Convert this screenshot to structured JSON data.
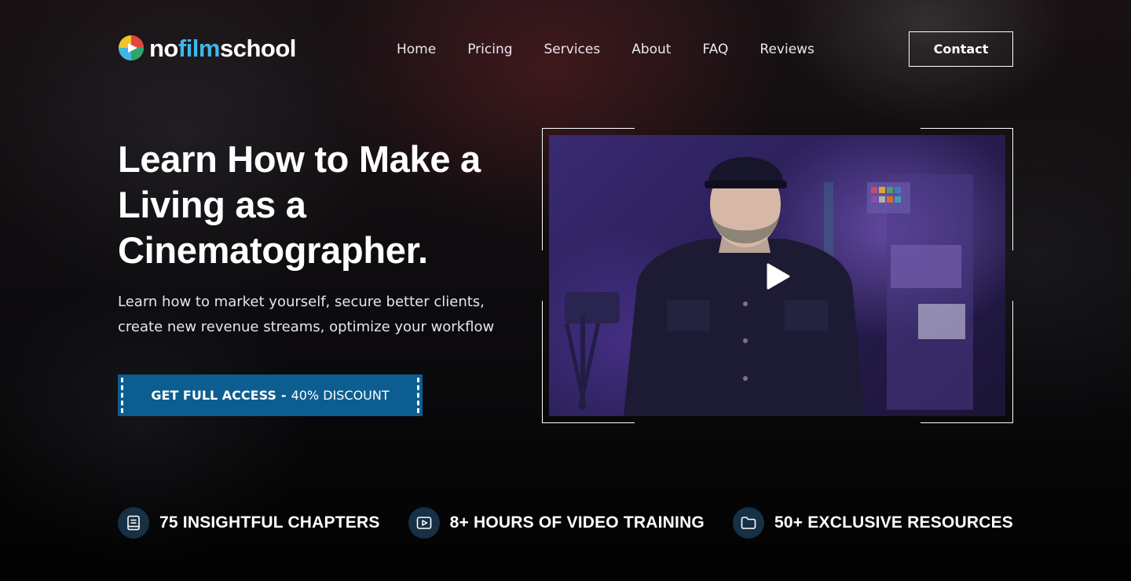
{
  "brand": {
    "part1": "no",
    "part2": "film",
    "part3": "school"
  },
  "nav": {
    "items": [
      {
        "label": "Home"
      },
      {
        "label": "Pricing"
      },
      {
        "label": "Services"
      },
      {
        "label": "About"
      },
      {
        "label": "FAQ"
      },
      {
        "label": "Reviews"
      }
    ],
    "contact_label": "Contact"
  },
  "hero": {
    "title": "Learn How to Make a Living as a Cinematographer.",
    "subtitle": "Learn how to market yourself, secure better clients, create new revenue streams, optimize your workflow",
    "cta": {
      "strong": "GET FULL ACCESS",
      "separator": "-",
      "light": "40% DISCOUNT",
      "color": "#0c5e91"
    }
  },
  "video": {
    "play_icon": "play-icon"
  },
  "features": [
    {
      "icon": "book-icon",
      "label": "75 INSIGHTFUL CHAPTERS"
    },
    {
      "icon": "video-play-icon",
      "label": "8+ HOURS OF VIDEO TRAINING"
    },
    {
      "icon": "folder-icon",
      "label": "50+ EXCLUSIVE RESOURCES"
    }
  ],
  "colors": {
    "accent": "#3fb6e8",
    "icon_bg": "#163046"
  }
}
